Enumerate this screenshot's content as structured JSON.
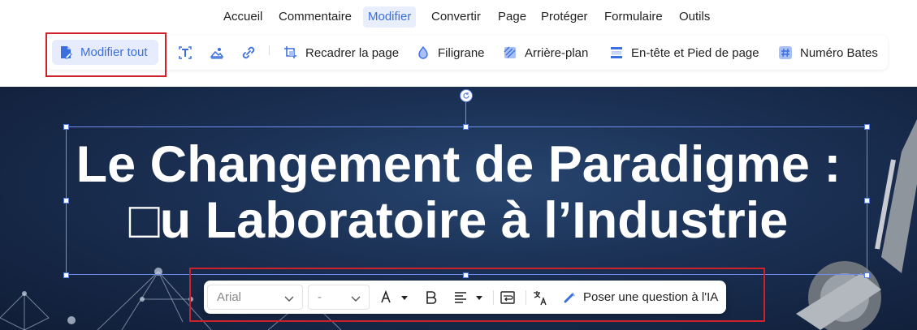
{
  "menu": {
    "items": [
      "Accueil",
      "Commentaire",
      "Modifier",
      "Convertir",
      "Page",
      "Protéger",
      "Formulaire",
      "Outils"
    ],
    "active": "Modifier"
  },
  "toolbar": {
    "modify_all": "Modifier tout",
    "crop_page": "Recadrer la page",
    "watermark": "Filigrane",
    "background": "Arrière-plan",
    "header_footer": "En-tête et Pied de page",
    "bates": "Numéro Bates"
  },
  "document": {
    "title_line1": "Le Changement de Paradigme :",
    "title_line2": "□u Laboratoire à l’Industrie"
  },
  "text_toolbar": {
    "font": "Arial",
    "size": "-",
    "ask_ai": "Poser une question à l'IA"
  },
  "colors": {
    "accent": "#3b6fe0",
    "highlight_red": "#d0202a",
    "canvas_bg": "#1a2f52"
  }
}
